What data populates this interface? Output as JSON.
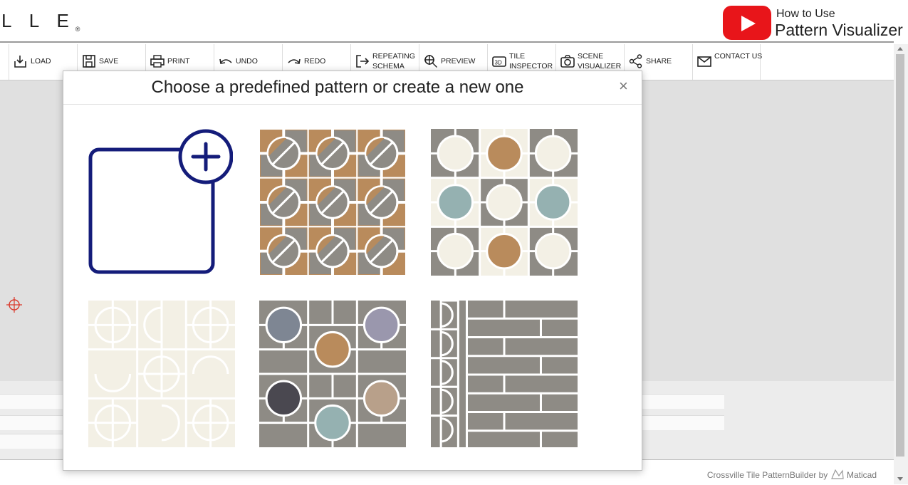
{
  "header": {
    "logo": "L L E",
    "logo_mark": "®",
    "video_line1": "How to Use",
    "video_line2": "Pattern Visualizer"
  },
  "toolbar": [
    {
      "label": "LOAD",
      "icon": "load-icon"
    },
    {
      "label": "SAVE",
      "icon": "save-icon"
    },
    {
      "label": "PRINT",
      "icon": "print-icon"
    },
    {
      "label": "UNDO",
      "icon": "undo-icon"
    },
    {
      "label": "REDO",
      "icon": "redo-icon"
    },
    {
      "label": "REPEATING SCHEMA",
      "icon": "repeating-schema-icon"
    },
    {
      "label": "PREVIEW",
      "icon": "preview-icon"
    },
    {
      "label": "TILE INSPECTOR",
      "icon": "tile-inspector-icon"
    },
    {
      "label": "SCENE VISUALIZER",
      "icon": "camera-icon"
    },
    {
      "label": "SHARE",
      "icon": "share-icon"
    },
    {
      "label": "CONTACT US",
      "icon": "mail-icon"
    }
  ],
  "modal": {
    "title": "Choose a predefined pattern or create a new one",
    "close": "×",
    "options": [
      {
        "name": "new-pattern",
        "icon": "add-new-icon"
      },
      {
        "name": "pattern-1"
      },
      {
        "name": "pattern-2"
      },
      {
        "name": "pattern-3"
      },
      {
        "name": "pattern-4"
      },
      {
        "name": "pattern-5"
      }
    ]
  },
  "footer": {
    "credit": "Crossville Tile PatternBuilder by",
    "brand": "Maticad"
  },
  "colors": {
    "gray": "#8e8b85",
    "tan": "#b98b5c",
    "cream": "#f3f0e5",
    "teal": "#95b1b1",
    "navy": "#141c7a",
    "youtube": "#e8151a"
  }
}
